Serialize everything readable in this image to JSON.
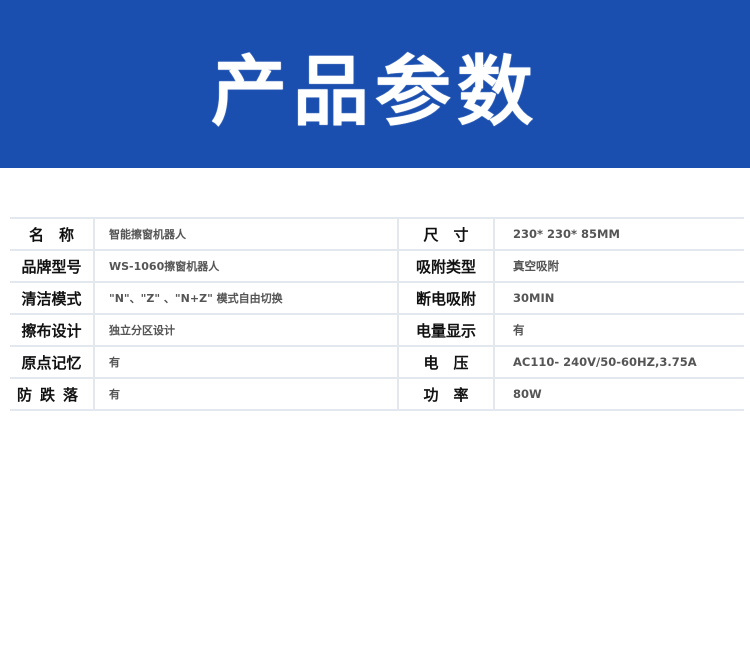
{
  "banner": {
    "title": "产品参数",
    "background": "#1a4fb0"
  },
  "specs": [
    {
      "label_left": "名　称",
      "value_left": "智能擦窗机器人",
      "label_right": "尺　寸",
      "value_right": "230* 230* 85MM"
    },
    {
      "label_left": "品牌型号",
      "value_left": "WS-1060擦窗机器人",
      "label_right": "吸附类型",
      "value_right": "真空吸附"
    },
    {
      "label_left": "清洁模式",
      "value_left": "\"N\"、\"Z\" 、\"N+Z\" 模式自由切换",
      "label_right": "断电吸附",
      "value_right": "30MIN"
    },
    {
      "label_left": "擦布设计",
      "value_left": "独立分区设计",
      "label_right": "电量显示",
      "value_right": "有"
    },
    {
      "label_left": "原点记忆",
      "value_left": "有",
      "label_right": "电　压",
      "value_right": "AC110- 240V/50-60HZ,3.75A"
    },
    {
      "label_left": "防跌落",
      "value_left": "有",
      "label_right": "功　率",
      "value_right": "80W"
    }
  ]
}
